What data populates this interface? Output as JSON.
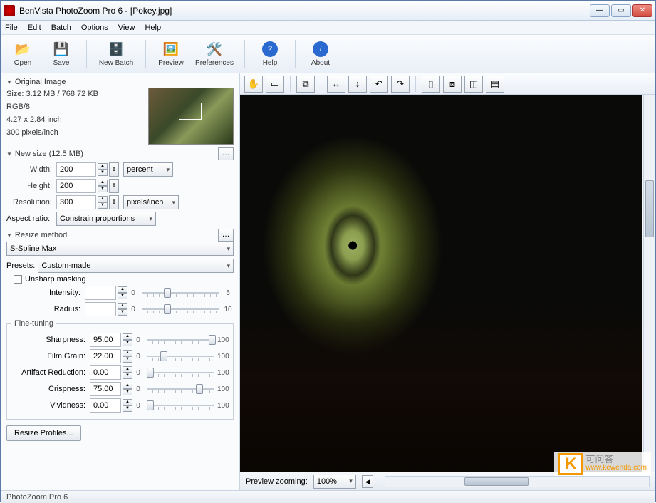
{
  "window": {
    "title": "BenVista PhotoZoom Pro 6 - [Pokey.jpg]"
  },
  "menu": {
    "file": "File",
    "edit": "Edit",
    "batch": "Batch",
    "options": "Options",
    "view": "View",
    "help": "Help"
  },
  "toolbar": {
    "open": "Open",
    "save": "Save",
    "newbatch": "New Batch",
    "preview": "Preview",
    "preferences": "Preferences",
    "help": "Help",
    "about": "About"
  },
  "original": {
    "header": "Original Image",
    "size": "Size: 3.12 MB / 768.72 KB",
    "mode": "RGB/8",
    "dims": "4.27 x 2.84 inch",
    "res": "300 pixels/inch"
  },
  "newsize": {
    "header": "New size (12.5 MB)",
    "width_lbl": "Width:",
    "width": "200",
    "height_lbl": "Height:",
    "height": "200",
    "unit": "percent",
    "res_lbl": "Resolution:",
    "res": "300",
    "res_unit": "pixels/inch",
    "aspect_lbl": "Aspect ratio:",
    "aspect": "Constrain proportions"
  },
  "resize": {
    "header": "Resize method",
    "method": "S-Spline Max",
    "presets_lbl": "Presets:",
    "preset": "Custom-made",
    "unsharp_lbl": "Unsharp masking",
    "intensity_lbl": "Intensity:",
    "intensity": "",
    "intensity_min": "0",
    "intensity_max": "5",
    "radius_lbl": "Radius:",
    "radius": "",
    "radius_min": "0",
    "radius_max": "10"
  },
  "finetune": {
    "legend": "Fine-tuning",
    "sharp_lbl": "Sharpness:",
    "sharp": "95.00",
    "grain_lbl": "Film Grain:",
    "grain": "22.00",
    "artifact_lbl": "Artifact Reduction:",
    "artifact": "0.00",
    "crisp_lbl": "Crispness:",
    "crisp": "75.00",
    "vivid_lbl": "Vividness:",
    "vivid": "0.00",
    "min": "0",
    "max": "100"
  },
  "resize_profiles": "Resize Profiles...",
  "previewbar": {
    "label": "Preview zooming:",
    "zoom": "100%"
  },
  "status": "PhotoZoom Pro 6",
  "watermark": {
    "cn": "可问答",
    "url": "www.kewenda.com"
  }
}
